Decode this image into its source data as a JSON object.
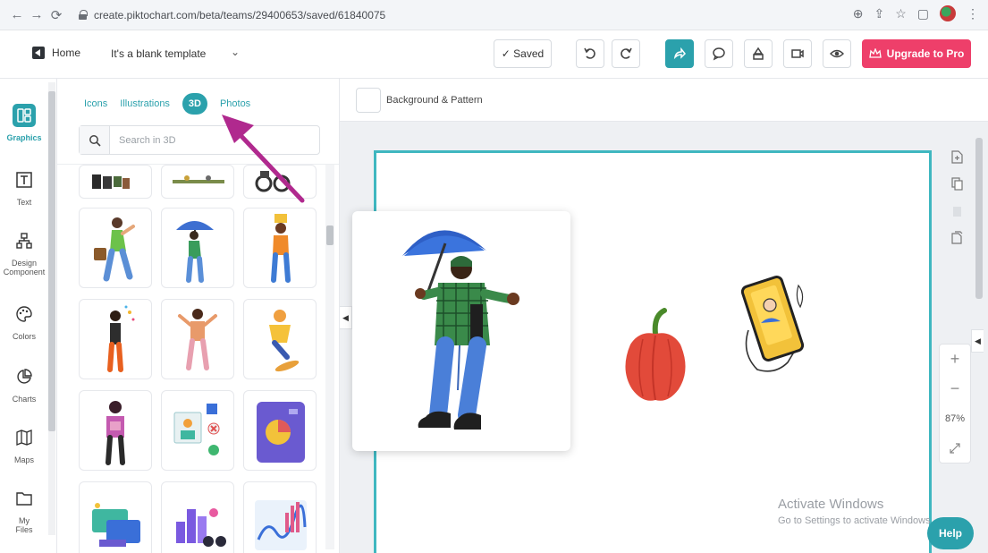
{
  "browser": {
    "url": "create.piktochart.com/beta/teams/29400653/saved/61840075",
    "icons": [
      "arrow-left",
      "arrow-right",
      "reload",
      "lock",
      "zoom",
      "share",
      "star",
      "sidebar",
      "profile",
      "menu"
    ]
  },
  "header": {
    "home_label": "Home",
    "doc_title": "It's a blank template",
    "saved_label": "✓ Saved",
    "upgrade_label": "Upgrade to Pro"
  },
  "rail": {
    "items": [
      {
        "label": "Graphics",
        "icon": "graphics-icon",
        "active": true
      },
      {
        "label": "Text",
        "icon": "text-icon",
        "active": false
      },
      {
        "label": "Design Component",
        "icon": "design-component-icon",
        "active": false
      },
      {
        "label": "Colors",
        "icon": "palette-icon",
        "active": false
      },
      {
        "label": "Charts",
        "icon": "chart-icon",
        "active": false
      },
      {
        "label": "Maps",
        "icon": "map-icon",
        "active": false
      },
      {
        "label": "My Files",
        "icon": "folder-icon",
        "active": false
      }
    ]
  },
  "panel": {
    "tabs": [
      "Icons",
      "Illustrations",
      "3D",
      "Photos"
    ],
    "active_tab": "3D",
    "search_placeholder": "Search in 3D"
  },
  "canvas": {
    "background_label": "Background & Pattern",
    "zoom_level": "87%",
    "activate_title": "Activate Windows",
    "activate_sub": "Go to Settings to activate Windows.",
    "help_label": "Help"
  },
  "colors": {
    "accent": "#2ba1ac",
    "upgrade": "#ee3f6a",
    "artboard_border": "#3fb7c0",
    "annotation_arrow": "#b0298e"
  }
}
